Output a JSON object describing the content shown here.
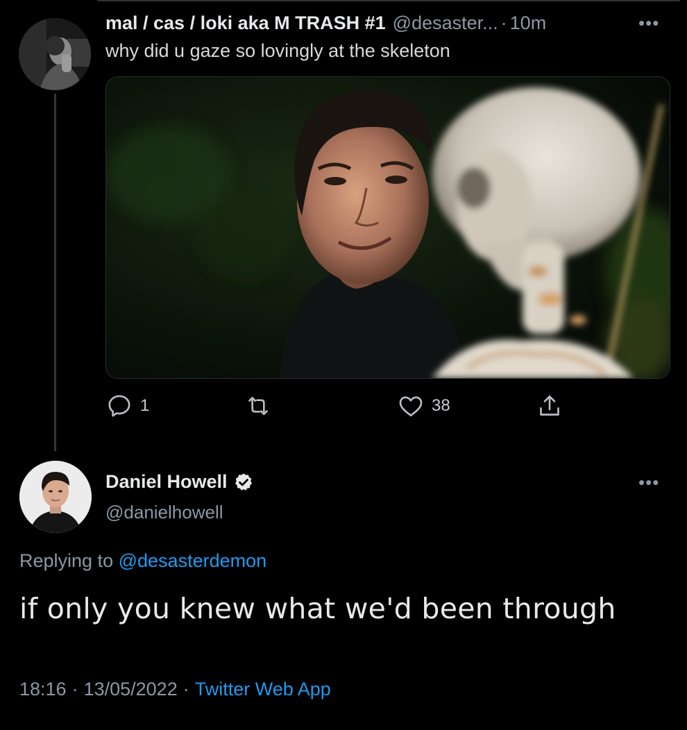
{
  "parent_tweet": {
    "author_name": "mal / cas / loki aka M TRASH #1",
    "handle": "@desaster...",
    "separator": "·",
    "time": "10m",
    "more_label": "•••",
    "text": "why did u gaze so lovingly at the skeleton",
    "actions": {
      "reply_count": "1",
      "retweet_count": "",
      "like_count": "38"
    }
  },
  "main_tweet": {
    "author_name": "Daniel Howell",
    "handle": "@danielhowell",
    "more_label": "•••",
    "replying_prefix": "Replying to",
    "replying_to": "@desasterdemon",
    "text": "if only you knew what we'd been through",
    "time": "18:16",
    "date": "13/05/2022",
    "separator": "·",
    "source": "Twitter Web App"
  },
  "colors": {
    "background": "#000000",
    "text_primary": "#e7e9ea",
    "text_secondary": "#8b98a5",
    "accent": "#1d9bf0"
  },
  "icons": {
    "reply": "speech-bubble-icon",
    "retweet": "retweet-arrows-icon",
    "like": "heart-icon",
    "share": "share-upload-icon",
    "verified": "verified-badge-icon",
    "more": "more-dots-icon"
  }
}
